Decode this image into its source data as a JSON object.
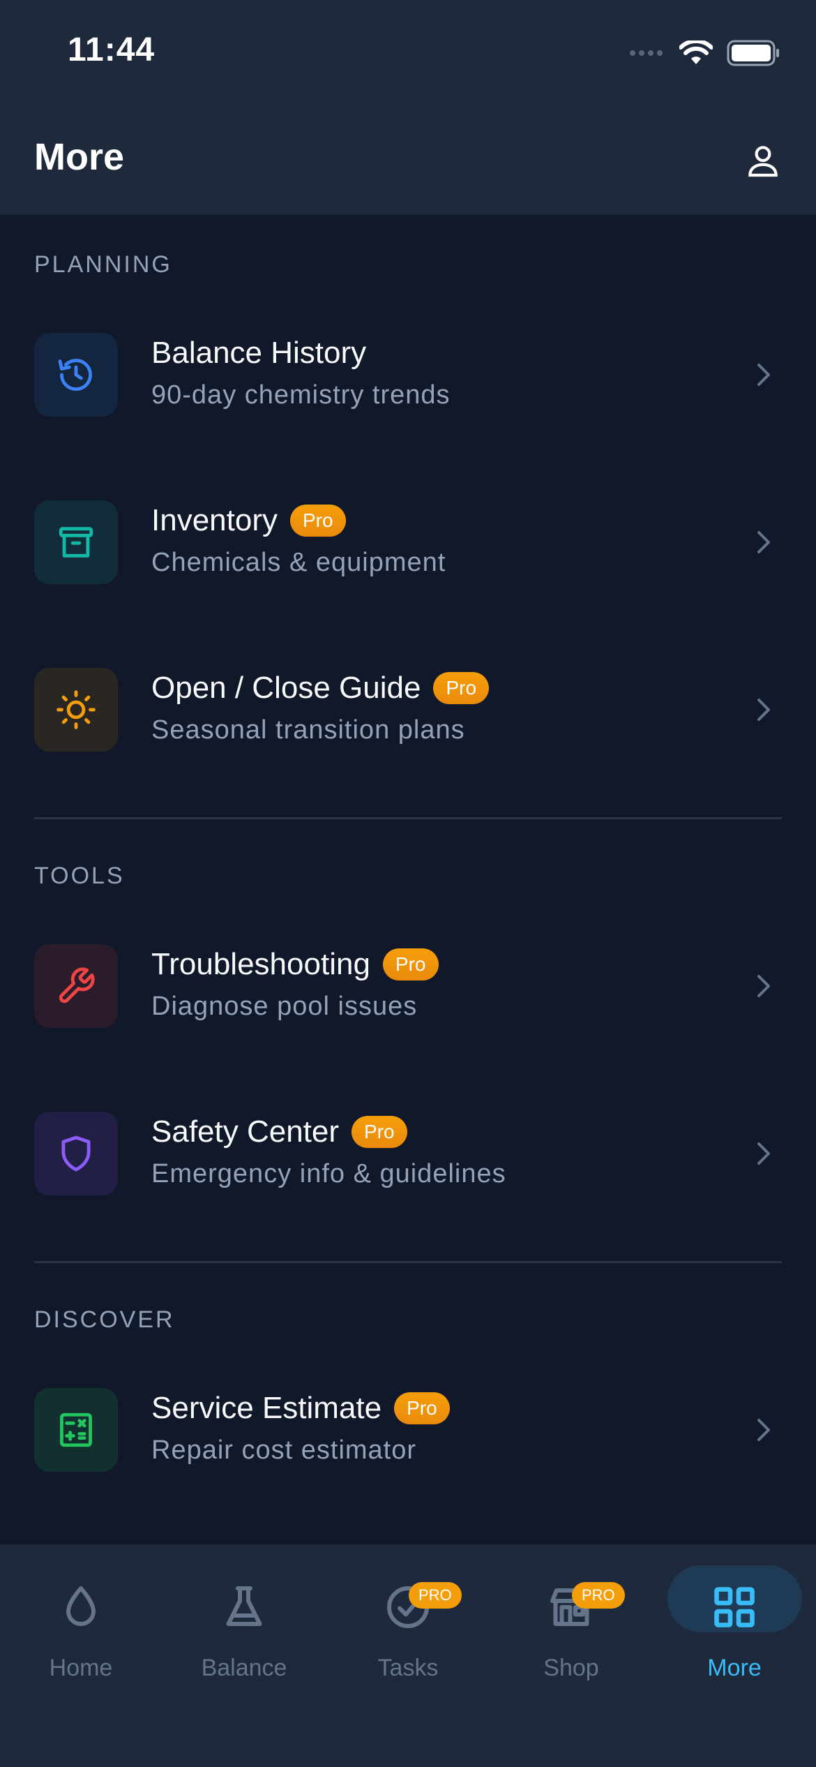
{
  "status": {
    "time": "11:44"
  },
  "header": {
    "title": "More"
  },
  "sections": [
    {
      "label": "PLANNING",
      "items": [
        {
          "title": "Balance History",
          "subtitle": "90-day chemistry trends",
          "pro": false,
          "icon": "history-icon",
          "color": "#3B82F6"
        },
        {
          "title": "Inventory",
          "subtitle": "Chemicals & equipment",
          "pro": true,
          "icon": "archive-box-icon",
          "color": "#14B8A6"
        },
        {
          "title": "Open / Close Guide",
          "subtitle": "Seasonal transition plans",
          "pro": true,
          "icon": "sun-icon",
          "color": "#F59E0B"
        }
      ]
    },
    {
      "label": "TOOLS",
      "items": [
        {
          "title": "Troubleshooting",
          "subtitle": "Diagnose pool issues",
          "pro": true,
          "icon": "wrench-icon",
          "color": "#EF4444"
        },
        {
          "title": "Safety Center",
          "subtitle": "Emergency info & guidelines",
          "pro": true,
          "icon": "shield-icon",
          "color": "#8B5CF6"
        }
      ]
    },
    {
      "label": "DISCOVER",
      "items": [
        {
          "title": "Service Estimate",
          "subtitle": "Repair cost estimator",
          "pro": true,
          "icon": "calculator-icon",
          "color": "#22C55E"
        }
      ]
    }
  ],
  "pro_badge": "Pro",
  "tabs": [
    {
      "label": "Home",
      "icon": "water-drop-icon",
      "active": false
    },
    {
      "label": "Balance",
      "icon": "flask-icon",
      "active": false
    },
    {
      "label": "Tasks",
      "icon": "check-circle-icon",
      "active": false,
      "badge": "PRO"
    },
    {
      "label": "Shop",
      "icon": "store-icon",
      "active": false,
      "badge": "PRO"
    },
    {
      "label": "More",
      "icon": "grid-icon",
      "active": true
    }
  ],
  "colors": {
    "accent": "#38BDF8",
    "pro": "#F59E0B",
    "background": "#111829",
    "surface": "#1E293B"
  }
}
